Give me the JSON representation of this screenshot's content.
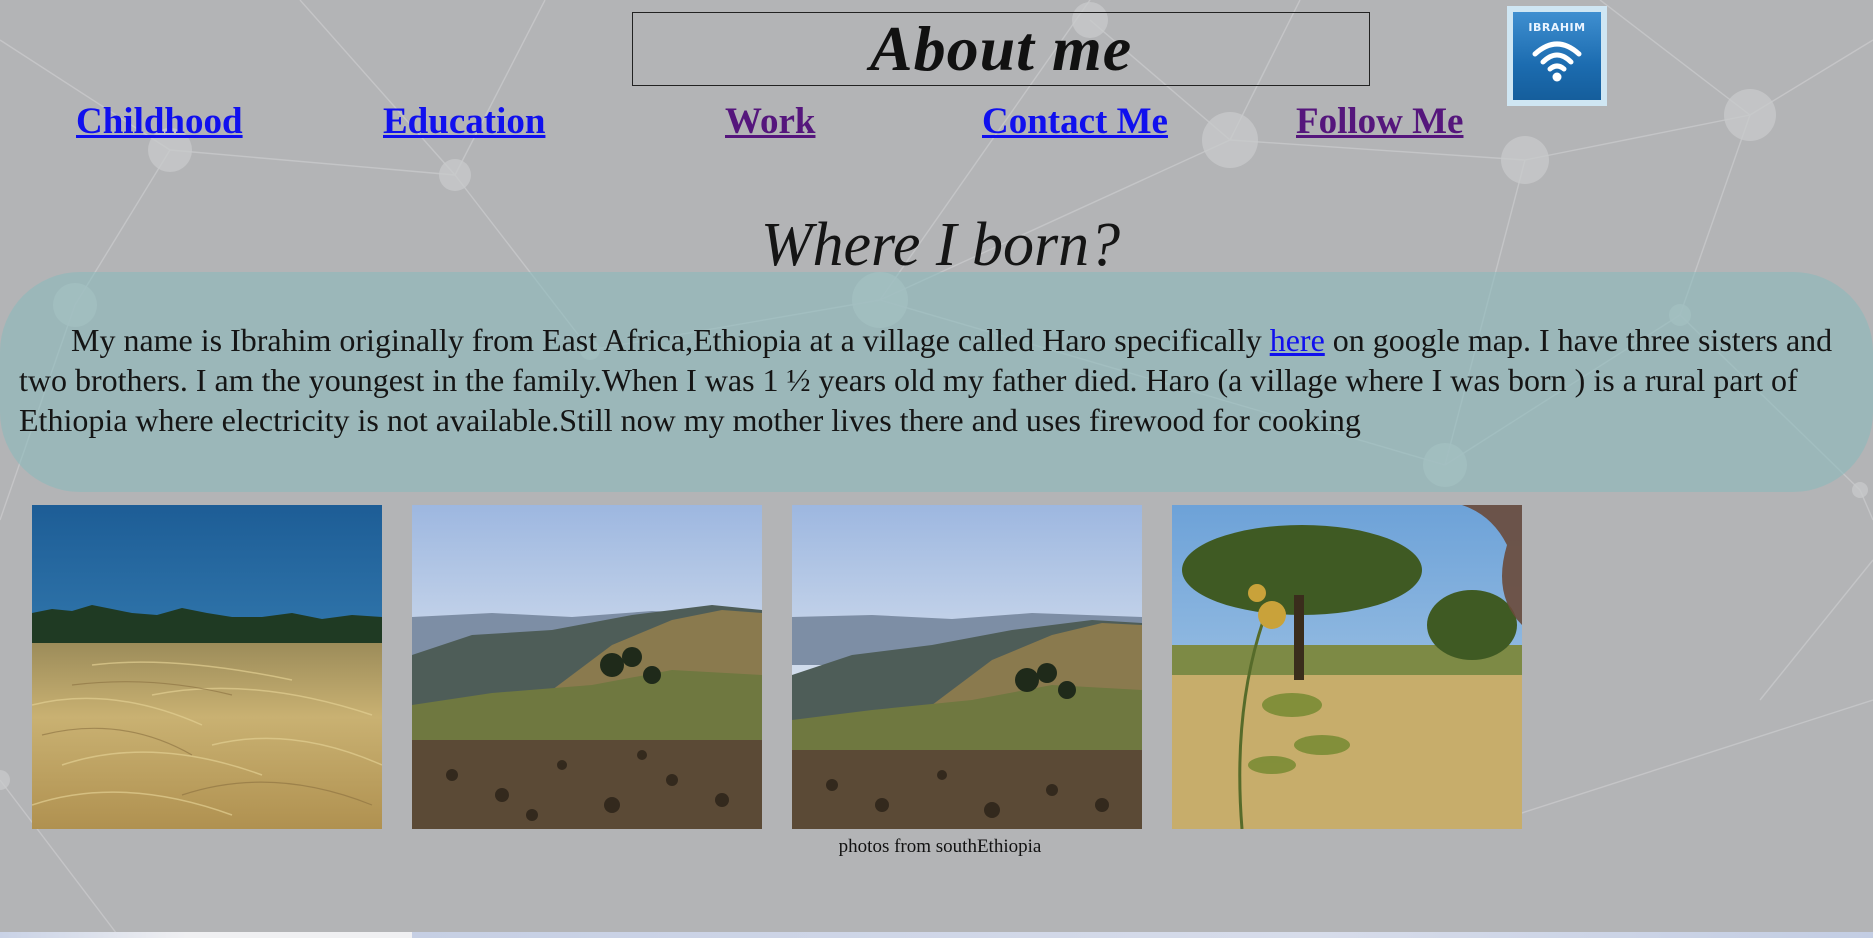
{
  "header": {
    "title": "About me",
    "logo_text": "IBRAHIM"
  },
  "nav": {
    "items": [
      {
        "label": "Childhood"
      },
      {
        "label": "Education"
      },
      {
        "label": "Work"
      },
      {
        "label": "Contact Me"
      },
      {
        "label": "Follow Me"
      }
    ]
  },
  "main": {
    "heading": "Where I born?",
    "bio_before_link": "My name is Ibrahim originally from East Africa,Ethiopia at a village called Haro specifically ",
    "bio_link_text": "here",
    "bio_after_link": " on google map. I have three sisters and two brothers. I am the youngest in the family.When I was 1 ½ years old my father died. Haro (a village where I was born ) is a rural part of Ethiopia where electricity is not available.Still now my mother lives there and uses firewood for cooking",
    "photos_caption": "photos from southEthiopia"
  },
  "colors": {
    "background": "#b3b4b6",
    "link": "#1010ee",
    "visited_link": "#55167c",
    "bio_band": "#8cbabc"
  },
  "icons": {
    "logo": "wifi-icon"
  }
}
